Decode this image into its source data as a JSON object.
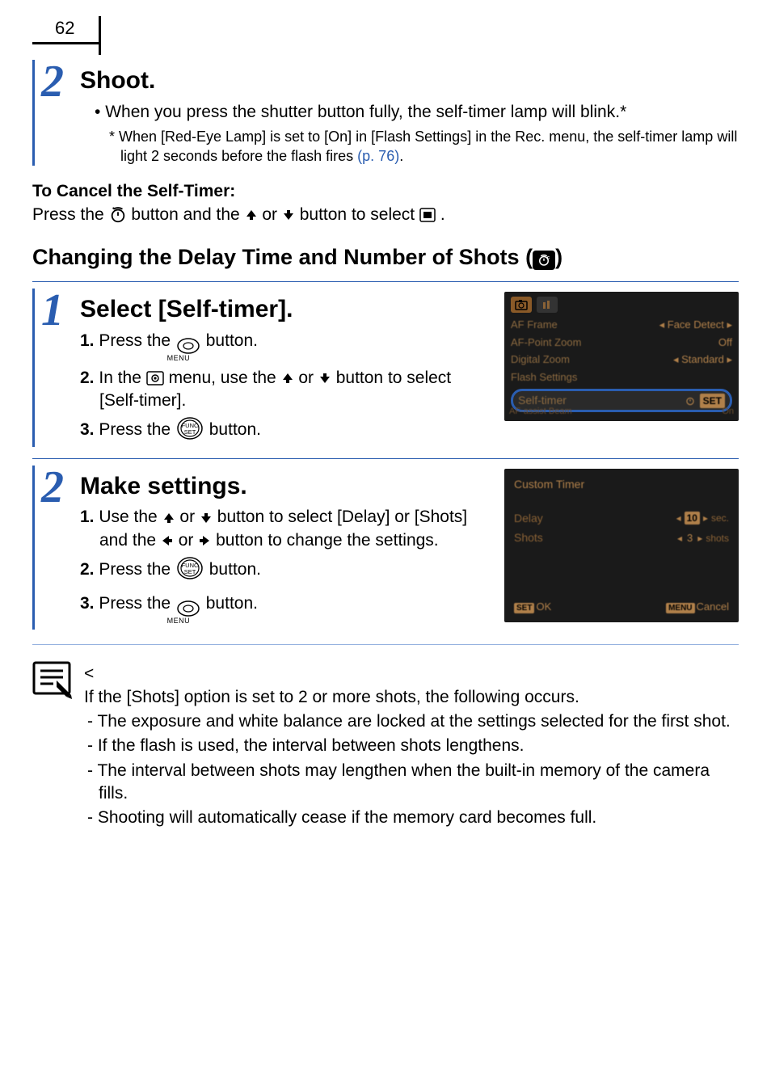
{
  "page_number": "62",
  "step2a": {
    "title": "Shoot.",
    "bullet": "When you press the shutter button fully, the self-timer lamp will blink.*",
    "footnote_pre": "*  When [Red-Eye Lamp] is set to [On] in [Flash Settings] in the Rec. menu, the self-timer lamp will light 2 seconds before the flash fires ",
    "footnote_link": "(p. 76)",
    "footnote_post": "."
  },
  "cancel": {
    "heading": "To Cancel the Self-Timer:",
    "line_pre": "Press the ",
    "line_mid1": " button and the ",
    "line_mid2": " or ",
    "line_mid3": " button to select ",
    "line_post": "."
  },
  "bigheading": {
    "pre": "Changing the Delay Time and Number of Shots (",
    "post": ")"
  },
  "step1": {
    "title": "Select [Self-timer].",
    "s1_pre": "Press the ",
    "s1_post": " button.",
    "s2_pre": "In the ",
    "s2_mid1": " menu, use the ",
    "s2_or": " or ",
    "s2_post": " button to select [Self-timer].",
    "s3_pre": "Press the ",
    "s3_post": " button."
  },
  "step2": {
    "title": "Make settings.",
    "s1_pre": "Use the ",
    "s1_or": " or ",
    "s1_mid": " button to select [Delay] or [Shots] and the ",
    "s1_or2": " or ",
    "s1_post": " button to change the settings.",
    "s2_pre": "Press the ",
    "s2_post": " button.",
    "s3_pre": "Press the ",
    "s3_post": " button."
  },
  "lcd1": {
    "r1l": "AF Frame",
    "r1r": "Face Detect",
    "r2l": "AF-Point Zoom",
    "r2r": "Off",
    "r3l": "Digital Zoom",
    "r3r": "Standard",
    "r4l": "Flash Settings",
    "hl_l": "Self-timer",
    "hl_r": "SET",
    "b1": "AF-assist Beam",
    "b2": "On"
  },
  "lcd2": {
    "title": "Custom Timer",
    "r1l": "Delay",
    "r1v": "10",
    "r1u": "sec.",
    "r2l": "Shots",
    "r2v": "3",
    "r2u": "shots",
    "ok_icon": "SET",
    "ok": "OK",
    "cancel_icon": "MENU",
    "cancel": "Cancel"
  },
  "note": {
    "intro": "If the [Shots] option is set to 2 or more shots, the following occurs.",
    "d1": "The exposure and white balance are locked at the settings selected for the first shot.",
    "d2": "If the flash is used, the interval between shots lengthens.",
    "d3": "The interval between shots may lengthen when the built-in memory of the camera fills.",
    "d4": "Shooting will automatically cease if the memory card becomes full."
  },
  "menu_label": "MENU"
}
